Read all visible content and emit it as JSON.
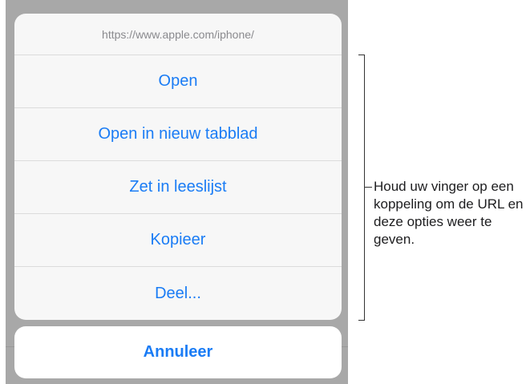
{
  "sheet": {
    "url": "https://www.apple.com/iphone/",
    "items": [
      {
        "label": "Open"
      },
      {
        "label": "Open in nieuw tabblad"
      },
      {
        "label": "Zet in leeslijst"
      },
      {
        "label": "Kopieer"
      },
      {
        "label": "Deel..."
      }
    ],
    "cancel_label": "Annuleer"
  },
  "callout": {
    "text": "Houd uw vinger op een koppeling om de URL en deze opties weer te geven."
  },
  "colors": {
    "accent": "#1a7cf5",
    "backdrop": "#a8a8a8",
    "sheet_bg": "#f7f7f7"
  }
}
